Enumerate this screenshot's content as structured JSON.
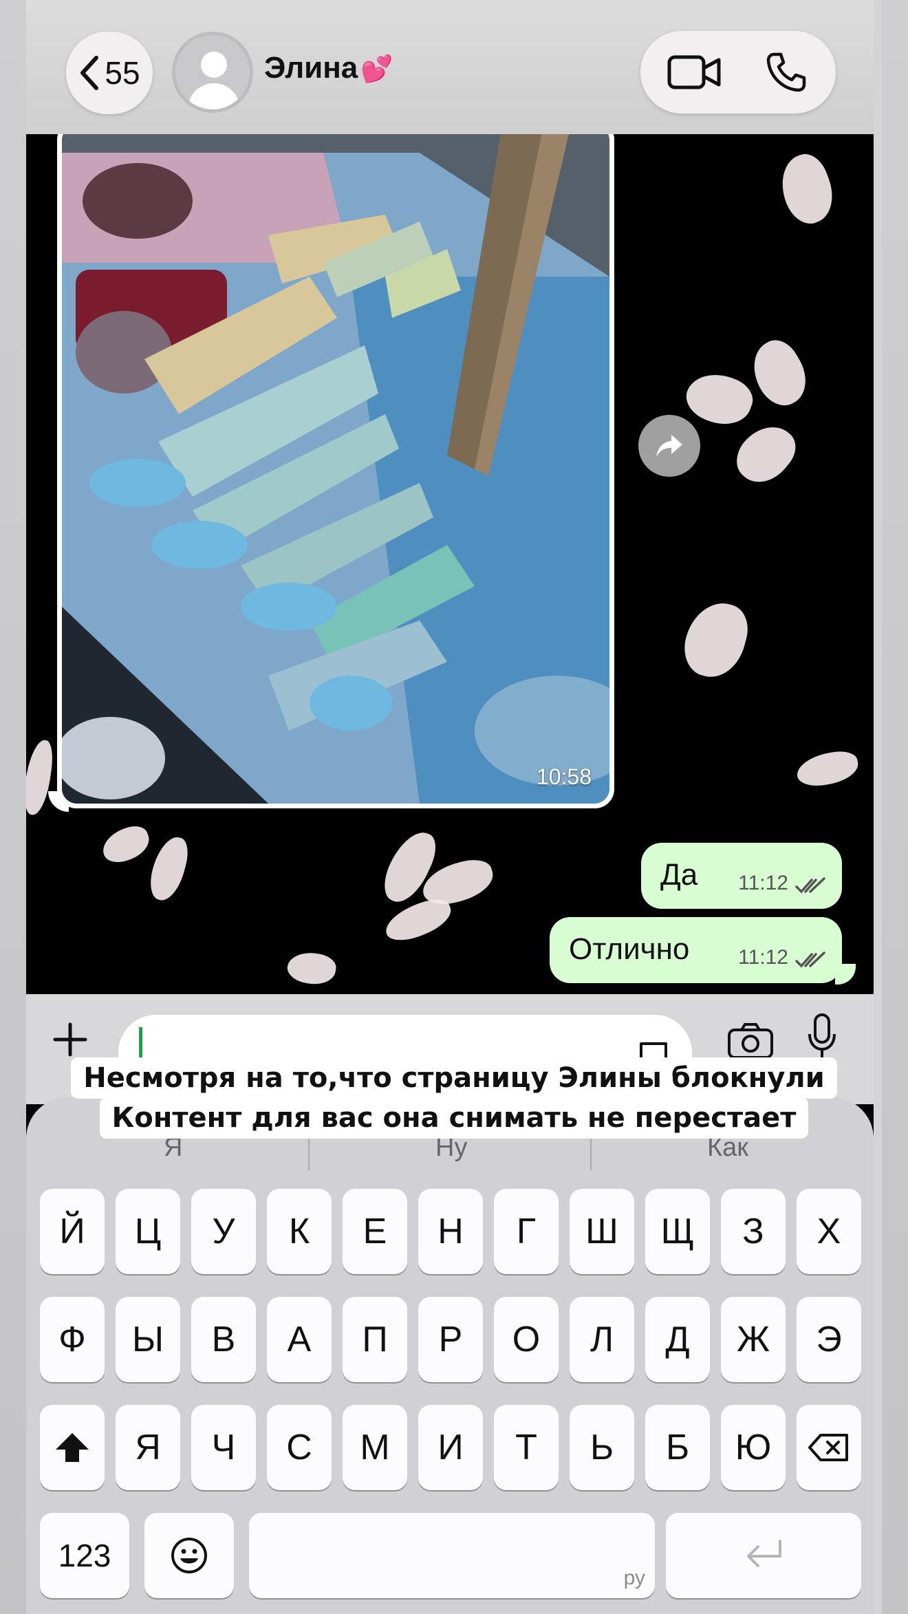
{
  "header": {
    "back_count": "55",
    "contact_name": "Элина",
    "contact_emoji": "💕"
  },
  "chat": {
    "image_message": {
      "time": "10:58"
    },
    "messages": [
      {
        "text": "Да",
        "time": "11:12"
      },
      {
        "text": "Отлично",
        "time": "11:12"
      }
    ]
  },
  "caption": {
    "line1": "Несмотря на то,что страницу Элины блокнули",
    "line2": "Контент для вас она снимать не перестает"
  },
  "keyboard": {
    "suggestions": [
      "Я",
      "Ну",
      "Как"
    ],
    "row1": [
      "Й",
      "Ц",
      "У",
      "К",
      "Е",
      "Н",
      "Г",
      "Ш",
      "Щ",
      "З",
      "Х"
    ],
    "row2": [
      "Ф",
      "Ы",
      "В",
      "А",
      "П",
      "Р",
      "О",
      "Л",
      "Д",
      "Ж",
      "Э"
    ],
    "row3": [
      "Я",
      "Ч",
      "С",
      "М",
      "И",
      "Т",
      "Ь",
      "Б",
      "Ю"
    ],
    "numbers_key": "123",
    "space_lang": "ру"
  }
}
